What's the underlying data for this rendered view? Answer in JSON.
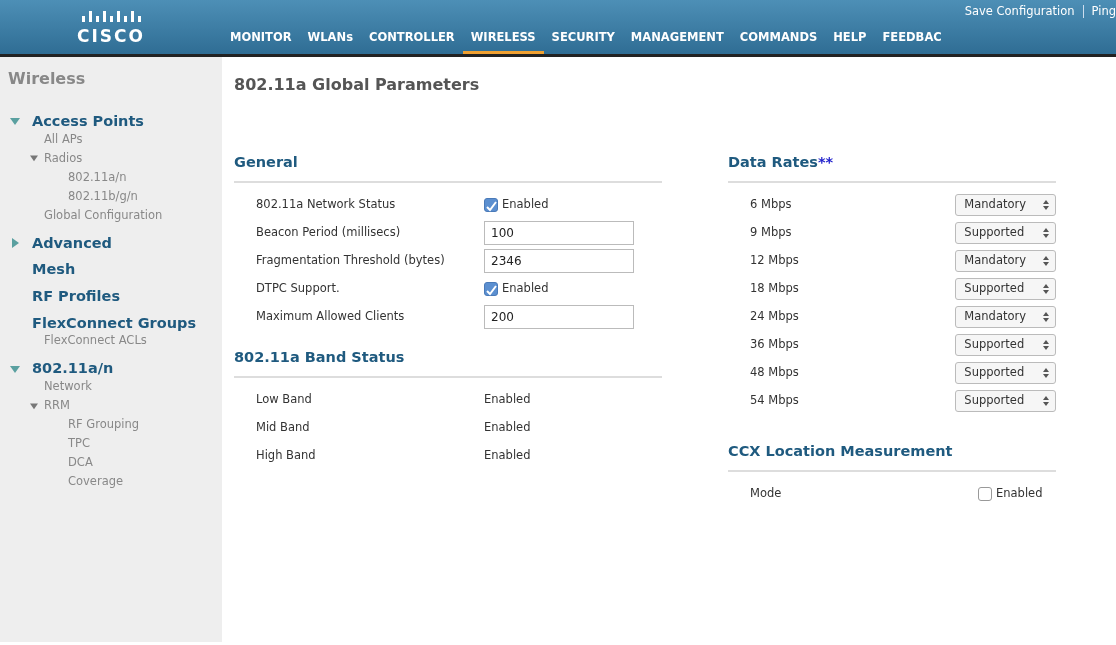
{
  "header": {
    "logo_text": "CISCO",
    "links": [
      "Save Configuration",
      "Ping"
    ],
    "nav": [
      {
        "label": "MONITOR",
        "selected": false
      },
      {
        "label": "WLANs",
        "selected": false
      },
      {
        "label": "CONTROLLER",
        "selected": false
      },
      {
        "label": "WIRELESS",
        "selected": true
      },
      {
        "label": "SECURITY",
        "selected": false
      },
      {
        "label": "MANAGEMENT",
        "selected": false
      },
      {
        "label": "COMMANDS",
        "selected": false
      },
      {
        "label": "HELP",
        "selected": false
      },
      {
        "label": "FEEDBAC",
        "selected": false
      }
    ]
  },
  "sidebar": {
    "title": "Wireless",
    "groups": [
      {
        "label": "Access Points",
        "kind": "folder",
        "expanded": true,
        "children": [
          {
            "label": "All APs"
          },
          {
            "label": "Radios",
            "expanded": true,
            "children": [
              {
                "label": "802.11a/n"
              },
              {
                "label": "802.11b/g/n"
              }
            ]
          },
          {
            "label": "Global Configuration"
          }
        ]
      },
      {
        "label": "Advanced",
        "kind": "folder",
        "expanded": false
      },
      {
        "label": "Mesh",
        "kind": "link"
      },
      {
        "label": "RF Profiles",
        "kind": "link"
      },
      {
        "label": "FlexConnect Groups",
        "kind": "link",
        "children": [
          {
            "label": "FlexConnect ACLs"
          }
        ]
      },
      {
        "label": "802.11a/n",
        "kind": "folder",
        "expanded": true,
        "children": [
          {
            "label": "Network"
          },
          {
            "label": "RRM",
            "expanded": true,
            "children": [
              {
                "label": "RF Grouping"
              },
              {
                "label": "TPC"
              },
              {
                "label": "DCA"
              },
              {
                "label": "Coverage"
              }
            ]
          }
        ]
      }
    ]
  },
  "page_title": "802.11a Global Parameters",
  "general": {
    "title": "General",
    "rows": [
      {
        "kind": "checkbox",
        "label": "802.11a Network Status",
        "checked": true,
        "text": "Enabled"
      },
      {
        "kind": "input",
        "label": "Beacon Period (millisecs)",
        "value": "100"
      },
      {
        "kind": "input",
        "label": "Fragmentation Threshold (bytes)",
        "value": "2346"
      },
      {
        "kind": "checkbox",
        "label": "DTPC Support.",
        "checked": true,
        "text": "Enabled"
      },
      {
        "kind": "input",
        "label": "Maximum Allowed Clients",
        "value": "200"
      }
    ]
  },
  "band_status": {
    "title": "802.11a Band Status",
    "rows": [
      {
        "label": "Low Band",
        "value": "Enabled"
      },
      {
        "label": "Mid Band",
        "value": "Enabled"
      },
      {
        "label": "High Band",
        "value": "Enabled"
      }
    ]
  },
  "data_rates": {
    "title": "Data Rates",
    "title_mark": "**",
    "rows": [
      {
        "label": "6 Mbps",
        "value": "Mandatory"
      },
      {
        "label": "9 Mbps",
        "value": "Supported"
      },
      {
        "label": "12 Mbps",
        "value": "Mandatory"
      },
      {
        "label": "18 Mbps",
        "value": "Supported"
      },
      {
        "label": "24 Mbps",
        "value": "Mandatory"
      },
      {
        "label": "36 Mbps",
        "value": "Supported"
      },
      {
        "label": "48 Mbps",
        "value": "Supported"
      },
      {
        "label": "54 Mbps",
        "value": "Supported"
      }
    ]
  },
  "ccx": {
    "title": "CCX Location Measurement",
    "rows": [
      {
        "kind": "checkbox",
        "label": "Mode",
        "checked": false,
        "text": "Enabled"
      }
    ]
  }
}
